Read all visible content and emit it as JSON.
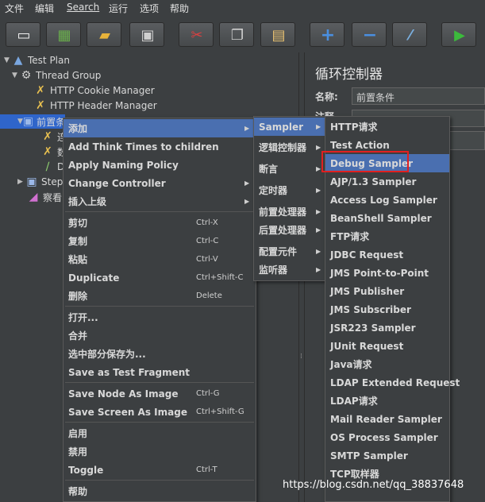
{
  "menubar": [
    "文件",
    "编辑",
    "Search",
    "运行",
    "选项",
    "帮助"
  ],
  "toolbar": [
    {
      "icon": "new-icon",
      "color": "#f0f0f0"
    },
    {
      "icon": "templates-icon",
      "color": "#6ab04c"
    },
    {
      "icon": "open-icon",
      "color": "#e8b33a"
    },
    {
      "icon": "save-icon",
      "color": "#cfcfcf"
    },
    {
      "icon": "cut-icon",
      "color": "#d94040"
    },
    {
      "icon": "copy-icon",
      "color": "#cfcfcf"
    },
    {
      "icon": "paste-icon",
      "color": "#e8c070"
    },
    {
      "icon": "expand-icon",
      "color": "#4a8fe0"
    },
    {
      "icon": "collapse-icon",
      "color": "#4a8fe0"
    },
    {
      "icon": "toggle-icon",
      "color": "#7ab0e0"
    },
    {
      "icon": "start-icon",
      "color": "#3cba3c"
    }
  ],
  "tree": [
    {
      "label": "Test Plan",
      "icon": "test-plan-icon",
      "arrow": "▼"
    },
    {
      "label": "Thread Group",
      "icon": "gear-icon",
      "arrow": "▼"
    },
    {
      "label": "HTTP Cookie Manager",
      "icon": "wrench-icon",
      "arrow": ""
    },
    {
      "label": "HTTP Header Manager",
      "icon": "wrench-icon",
      "arrow": ""
    },
    {
      "label": "前置条件",
      "icon": "controller-icon",
      "arrow": "▼"
    },
    {
      "label": "连",
      "icon": "wrench-icon",
      "arrow": ""
    },
    {
      "label": "数",
      "icon": "wrench-icon",
      "arrow": ""
    },
    {
      "label": "De",
      "icon": "pipette-icon",
      "arrow": ""
    },
    {
      "label": "Step",
      "icon": "controller-icon",
      "arrow": "▶"
    },
    {
      "label": "察看",
      "icon": "chart-icon",
      "arrow": ""
    }
  ],
  "right_panel": {
    "title": "循环控制器",
    "name_label": "名称:",
    "name_value": "前置条件",
    "comment_label": "注释"
  },
  "context_menu": {
    "items": [
      {
        "label": "添加",
        "shortcut": "",
        "sub": true,
        "highlight": true
      },
      {
        "label": "Add Think Times to children",
        "shortcut": "",
        "sub": false
      },
      {
        "label": "Apply Naming Policy",
        "shortcut": "",
        "sub": false
      },
      {
        "label": "Change Controller",
        "shortcut": "",
        "sub": true
      },
      {
        "label": "插入上级",
        "shortcut": "",
        "sub": true
      },
      {
        "sep": true
      },
      {
        "label": "剪切",
        "shortcut": "Ctrl-X",
        "sub": false
      },
      {
        "label": "复制",
        "shortcut": "Ctrl-C",
        "sub": false
      },
      {
        "label": "粘贴",
        "shortcut": "Ctrl-V",
        "sub": false
      },
      {
        "label": "Duplicate",
        "shortcut": "Ctrl+Shift-C",
        "sub": false
      },
      {
        "label": "删除",
        "shortcut": "Delete",
        "sub": false
      },
      {
        "sep": true
      },
      {
        "label": "打开...",
        "shortcut": "",
        "sub": false
      },
      {
        "label": "合并",
        "shortcut": "",
        "sub": false
      },
      {
        "label": "选中部分保存为...",
        "shortcut": "",
        "sub": false
      },
      {
        "label": "Save as Test Fragment",
        "shortcut": "",
        "sub": false
      },
      {
        "sep": true
      },
      {
        "label": "Save Node As Image",
        "shortcut": "Ctrl-G",
        "sub": false
      },
      {
        "label": "Save Screen As Image",
        "shortcut": "Ctrl+Shift-G",
        "sub": false
      },
      {
        "sep": true
      },
      {
        "label": "启用",
        "shortcut": "",
        "sub": false
      },
      {
        "label": "禁用",
        "shortcut": "",
        "sub": false
      },
      {
        "label": "Toggle",
        "shortcut": "Ctrl-T",
        "sub": false
      },
      {
        "sep": true
      },
      {
        "label": "帮助",
        "shortcut": "",
        "sub": false
      }
    ]
  },
  "add_submenu": {
    "items": [
      {
        "label": "Sampler",
        "sub": true,
        "highlight": true
      },
      {
        "label": "逻辑控制器",
        "sub": true
      },
      {
        "label": "断言",
        "sub": true
      },
      {
        "label": "定时器",
        "sub": true
      },
      {
        "label": "前置处理器",
        "sub": true
      },
      {
        "label": "后置处理器",
        "sub": true
      },
      {
        "label": "配置元件",
        "sub": true
      },
      {
        "label": "监听器",
        "sub": true
      }
    ]
  },
  "sampler_submenu": {
    "items": [
      "HTTP请求",
      "Test Action",
      "Debug Sampler",
      "AJP/1.3 Sampler",
      "Access Log Sampler",
      "BeanShell Sampler",
      "FTP请求",
      "JDBC Request",
      "JMS Point-to-Point",
      "JMS Publisher",
      "JMS Subscriber",
      "JSR223 Sampler",
      "JUnit Request",
      "Java请求",
      "LDAP Extended Request",
      "LDAP请求",
      "Mail Reader Sampler",
      "OS Process Sampler",
      "SMTP Sampler",
      "TCP取样器"
    ],
    "highlight_index": 2
  },
  "watermark": "https://blog.csdn.net/qq_38837648",
  "colors": {
    "selection": "#2f65ca",
    "menu_highlight": "#4a6fb0",
    "annotation": "#e02020"
  }
}
